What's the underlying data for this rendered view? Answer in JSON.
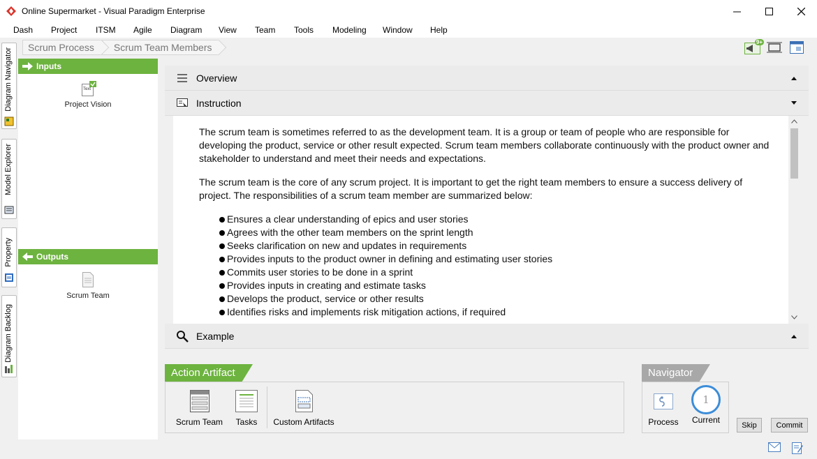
{
  "window": {
    "title": "Online Supermarket - Visual Paradigm Enterprise"
  },
  "menu": {
    "items": [
      "Dash",
      "Project",
      "ITSM",
      "Agile",
      "Diagram",
      "View",
      "Team",
      "Tools",
      "Modeling",
      "Window",
      "Help"
    ]
  },
  "side_tabs": {
    "diagram_navigator": "Diagram Navigator",
    "model_explorer": "Model Explorer",
    "property": "Property",
    "diagram_backlog": "Diagram Backlog"
  },
  "breadcrumb": [
    "Scrum Process",
    "Scrum Team Members"
  ],
  "notification_badge": "9+",
  "inputs": {
    "header": "Inputs",
    "items": [
      {
        "label": "Project Vision",
        "icon": "text-doc-icon",
        "icon_text": "Text"
      }
    ]
  },
  "outputs": {
    "header": "Outputs",
    "items": [
      {
        "label": "Scrum Team",
        "icon": "doc-icon"
      }
    ]
  },
  "overview": {
    "label": "Overview"
  },
  "instruction": {
    "label": "Instruction",
    "paragraphs": [
      "The scrum team is sometimes referred to as the development team. It is a group or team of people who are responsible for developing the product, service or other result expected. Scrum team members collaborate continuously with the product owner and stakeholder to understand and meet their needs and expectations.",
      "The scrum team is the core of any scrum project. It is important to get the right team members to ensure a success delivery of project. The responsibilities of a scrum team member are summarized below:"
    ],
    "bullets": [
      "Ensures a clear understanding of epics and user stories",
      "Agrees with the other team members on the sprint length",
      "Seeks clarification on new and updates in requirements",
      "Provides inputs to the product owner in defining and estimating user stories",
      "Commits user stories to be done in a sprint",
      "Provides inputs in creating and estimate tasks",
      "Develops the product, service or other results",
      "Identifies risks and implements risk mitigation actions, if required"
    ]
  },
  "example": {
    "label": "Example"
  },
  "action_artifact": {
    "title": "Action Artifact",
    "tools": [
      "Scrum Team",
      "Tasks",
      "Custom Artifacts"
    ]
  },
  "navigator": {
    "title": "Navigator",
    "process_label": "Process",
    "current_label": "Current",
    "current_number": "1"
  },
  "buttons": {
    "skip": "Skip",
    "commit": "Commit"
  },
  "colors": {
    "accent_green": "#6db33f",
    "navigator_grey": "#a8a8a8",
    "current_ring": "#3c8dd8"
  }
}
